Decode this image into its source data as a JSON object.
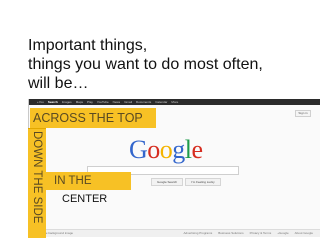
{
  "heading": {
    "line1": "Important things,",
    "line2": "things you want to do most often,",
    "line3": "will be…"
  },
  "screenshot": {
    "nav_items": [
      "+You",
      "Search",
      "Images",
      "Maps",
      "Play",
      "YouTube",
      "News",
      "Gmail",
      "Documents",
      "Calendar",
      "More"
    ],
    "active_nav": "Search",
    "sign_in_label": "Sign in",
    "logo_text": "Google",
    "search_button_label": "Google Search",
    "lucky_button_label": "I'm Feeling Lucky",
    "footer_left": "Change background image",
    "footer_right": [
      "Advertising Programs",
      "Business Solutions",
      "Privacy & Terms",
      "+Google",
      "About Google"
    ]
  },
  "callouts": {
    "top": "Across the top",
    "side": "Down the side",
    "center_line1": "In the",
    "center_line2": "center"
  },
  "colors": {
    "callout_fill": "#f7c125",
    "callout_text": "#5a4a22",
    "topbar": "#2b2b2b"
  }
}
